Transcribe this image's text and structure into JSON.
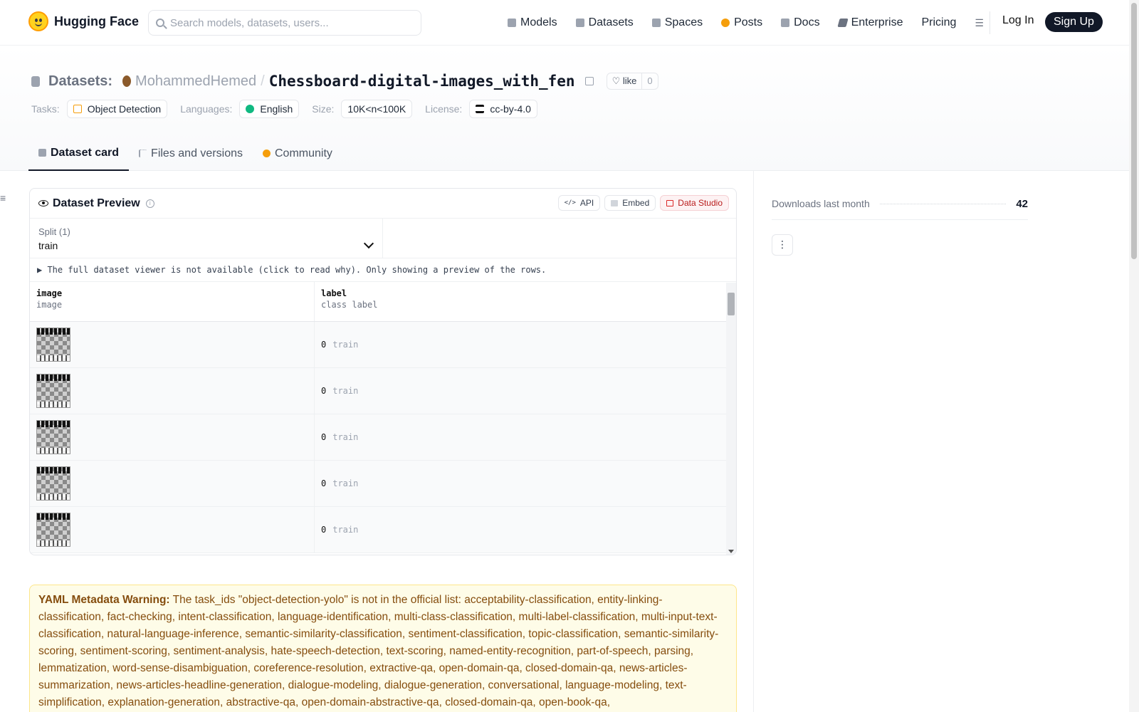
{
  "nav": {
    "brand": "Hugging Face",
    "search_placeholder": "Search models, datasets, users...",
    "links": [
      {
        "label": "Models",
        "icon": "cube-icon",
        "color": "#9ca3af"
      },
      {
        "label": "Datasets",
        "icon": "database-icon",
        "color": "#9ca3af"
      },
      {
        "label": "Spaces",
        "icon": "grid-icon",
        "color": "#9ca3af"
      },
      {
        "label": "Posts",
        "icon": "chat-bubble-icon",
        "color": "#f59e0b"
      },
      {
        "label": "Docs",
        "icon": "book-icon",
        "color": "#9ca3af"
      },
      {
        "label": "Enterprise",
        "icon": "enterprise-icon",
        "color": "#9ca3af"
      },
      {
        "label": "Pricing",
        "icon": "",
        "color": ""
      }
    ],
    "more_icon": "list-menu-icon",
    "login": "Log In",
    "signup": "Sign Up"
  },
  "header": {
    "category": "Datasets:",
    "owner": "MohammedHemed",
    "separator": "/",
    "repo": "Chessboard-digital-images_with_fen",
    "like_label": "like",
    "like_count": "0",
    "tags": [
      {
        "category": "Tasks:",
        "value": "Object Detection",
        "icon_color": "#f59e0b"
      },
      {
        "category": "Languages:",
        "value": "English",
        "icon_color": "#10b981"
      },
      {
        "category": "Size:",
        "value": "10K<n<100K",
        "icon_color": ""
      },
      {
        "category": "License:",
        "value": "cc-by-4.0",
        "icon_color": "#111827"
      }
    ]
  },
  "tabs": [
    {
      "label": "Dataset card",
      "active": true,
      "icon_color": "#9ca3af"
    },
    {
      "label": "Files and versions",
      "active": false,
      "icon_color": "#9ca3af"
    },
    {
      "label": "Community",
      "active": false,
      "icon_color": "#f59e0b"
    }
  ],
  "preview": {
    "title": "Dataset Preview",
    "buttons": {
      "api": "API",
      "embed": "Embed",
      "studio": "Data Studio"
    },
    "split_label": "Split (1)",
    "split_value": "train",
    "notice": "▶ The full dataset viewer is not available (click to read why). Only showing a preview of the rows.",
    "columns": [
      {
        "name": "image",
        "type": "image"
      },
      {
        "name": "label",
        "type": "class label"
      }
    ],
    "rows": [
      {
        "label_num": "0",
        "label_text": "train"
      },
      {
        "label_num": "0",
        "label_text": "train"
      },
      {
        "label_num": "0",
        "label_text": "train"
      },
      {
        "label_num": "0",
        "label_text": "train"
      },
      {
        "label_num": "0",
        "label_text": "train"
      }
    ]
  },
  "warning": {
    "title": "YAML Metadata Warning:",
    "text": " The task_ids \"object-detection-yolo\" is not in the official list: acceptability-classification, entity-linking-classification, fact-checking, intent-classification, language-identification, multi-class-classification, multi-label-classification, multi-input-text-classification, natural-language-inference, semantic-similarity-classification, sentiment-classification, topic-classification, semantic-similarity-scoring, sentiment-scoring, sentiment-analysis, hate-speech-detection, text-scoring, named-entity-recognition, part-of-speech, parsing, lemmatization, word-sense-disambiguation, coreference-resolution, extractive-qa, open-domain-qa, closed-domain-qa, news-articles-summarization, news-articles-headline-generation, dialogue-modeling, dialogue-generation, conversational, language-modeling, text-simplification, explanation-generation, abstractive-qa, open-domain-abstractive-qa, closed-domain-qa, open-book-qa,"
  },
  "sidebar": {
    "downloads_label": "Downloads last month",
    "downloads_value": "42",
    "more_label": "⋮"
  }
}
